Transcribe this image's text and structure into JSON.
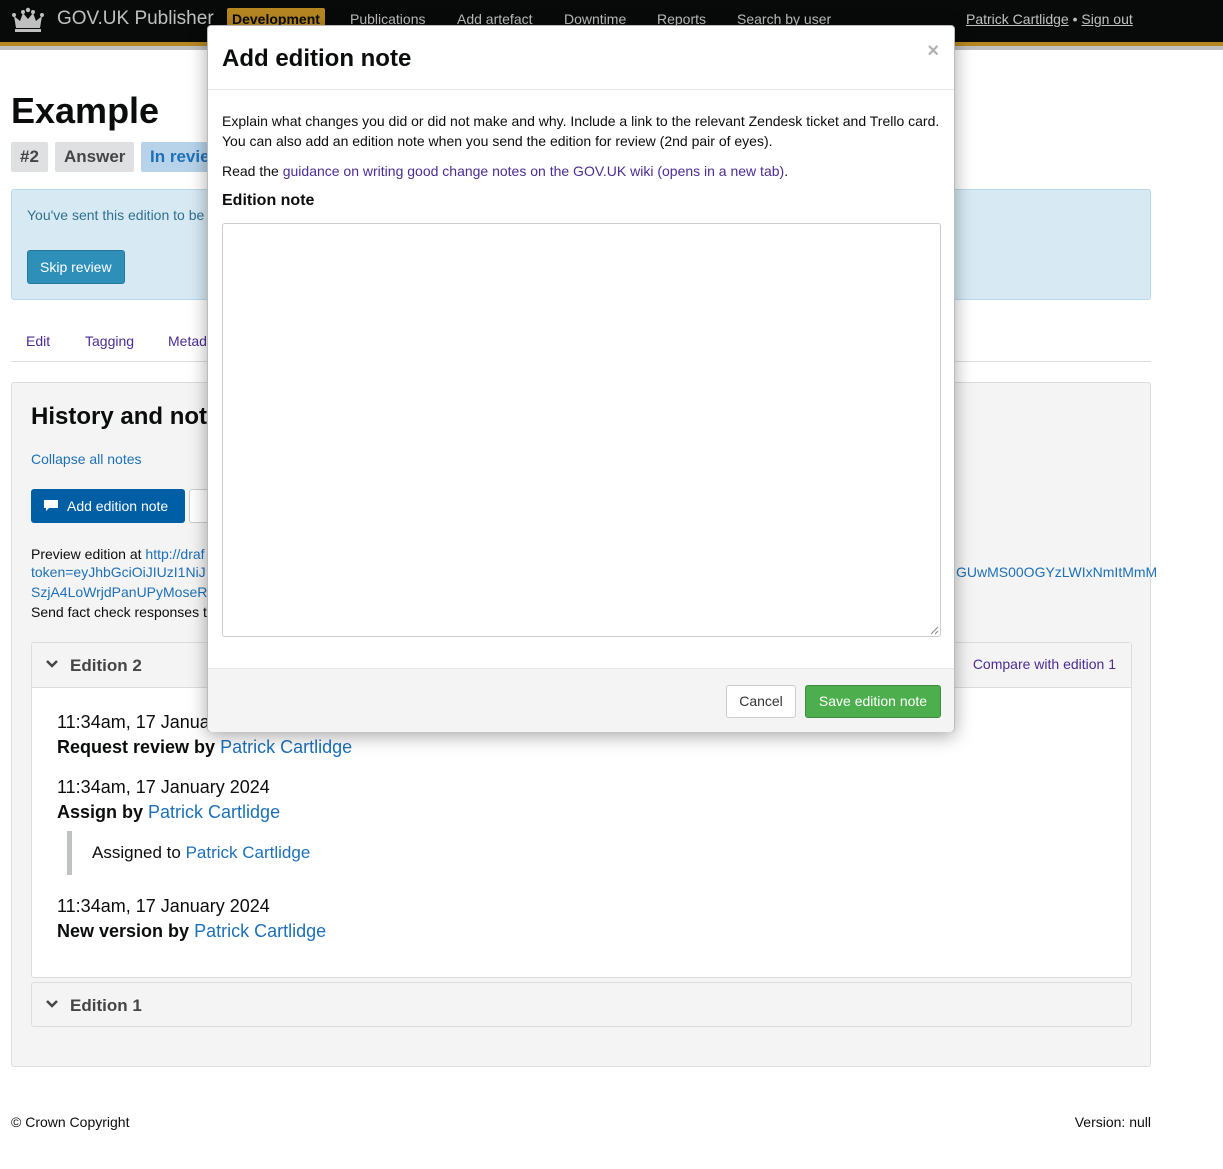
{
  "header": {
    "brand": "GOV.UK Publisher",
    "environment": "Development",
    "nav": [
      "Publications",
      "Add artefact",
      "Downtime",
      "Reports",
      "Search by user"
    ],
    "user_name": "Patrick Cartlidge",
    "separator": " • ",
    "sign_out": "Sign out"
  },
  "page": {
    "title": "Example",
    "tags": [
      "#2",
      "Answer",
      "In revie"
    ],
    "notice_text": "You've sent this edition to be",
    "skip_review": "Skip review",
    "tabs": [
      "Edit",
      "Tagging",
      "Metad"
    ]
  },
  "history": {
    "title": "History and note",
    "collapse_all": "Collapse all notes",
    "add_note_button": "Add edition note",
    "preview_prefix": "Preview edition at ",
    "preview_link": "http://draf",
    "token_start": "token=eyJhbGciOiJIUzI1NiJ",
    "token_end": "GUwMS00OGYzLWIxNmItMmM",
    "token_line2": "SzjA4LoWrjdPanUPyMoseR",
    "factcheck": "Send fact check responses t",
    "edition2": {
      "title": "Edition 2",
      "compare": "Compare with edition 1",
      "entries": [
        {
          "time": "11:34am, 17 Janua",
          "action": "Request review by ",
          "user": "Patrick Cartlidge"
        },
        {
          "time": "11:34am, 17 January 2024",
          "action": "Assign by ",
          "user": "Patrick Cartlidge"
        },
        {
          "time": "11:34am, 17 January 2024",
          "action": "New version by ",
          "user": "Patrick Cartlidge"
        }
      ],
      "quote_prefix": "Assigned to ",
      "quote_user": "Patrick Cartlidge"
    },
    "edition1": {
      "title": "Edition 1"
    }
  },
  "footer": {
    "copyright": "© Crown Copyright",
    "version": "Version: null"
  },
  "modal": {
    "title": "Add edition note",
    "close": "×",
    "intro": "Explain what changes you did or did not make and why. Include a link to the relevant Zendesk ticket and Trello card. You can also add an edition note when you send the edition for review (2nd pair of eyes).",
    "read_prefix": "Read the ",
    "guidance_link": "guidance on writing good change notes on the GOV.UK wiki (opens in a new tab)",
    "read_suffix": ".",
    "field_label": "Edition note",
    "note_value": "",
    "cancel": "Cancel",
    "save": "Save edition note"
  },
  "colors": {
    "header_bg": "#0b0c0c",
    "header_accent": "#f3b32c",
    "link_blue": "#1d70b8",
    "visited_purple": "#4c2c92",
    "primary_button": "#005ea5",
    "save_green": "#4cae4c"
  }
}
